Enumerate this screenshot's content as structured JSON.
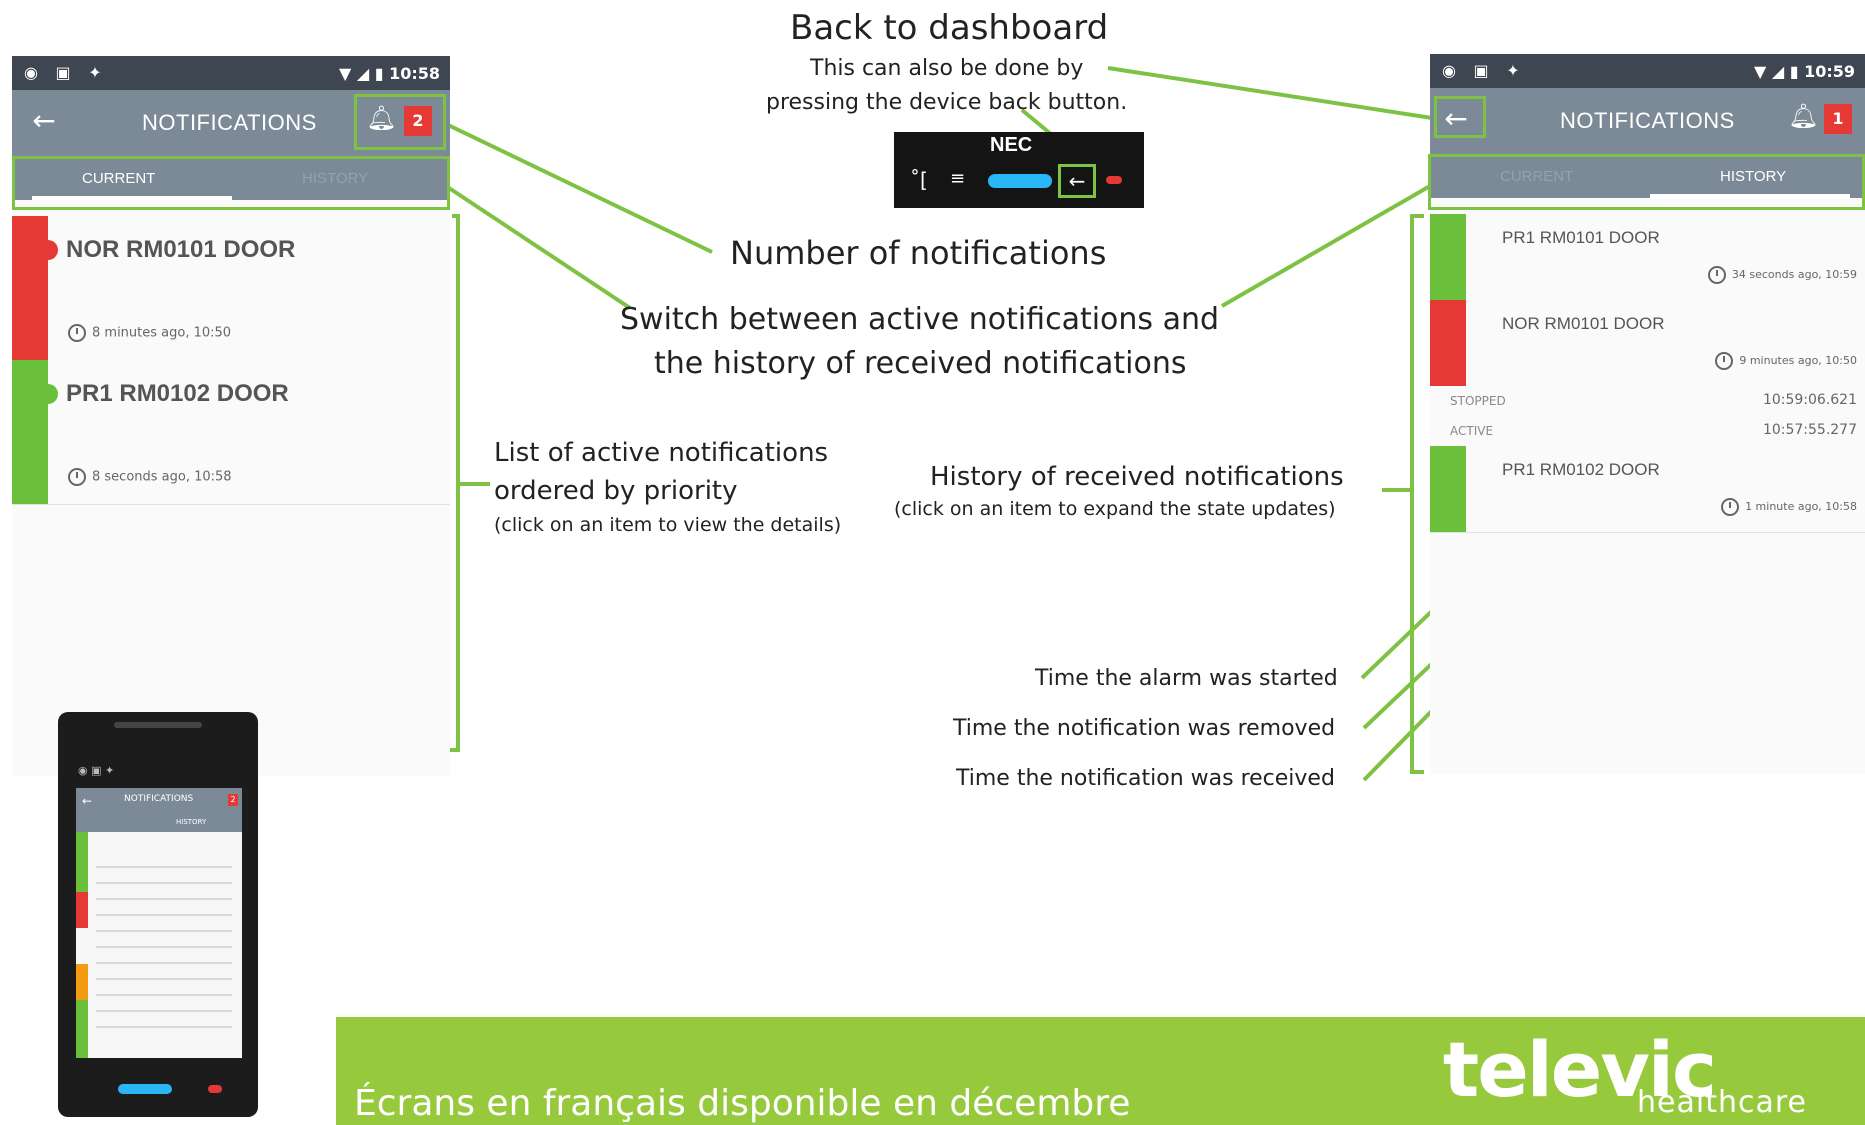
{
  "annotations": {
    "back_title": "Back to dashboard",
    "back_line1": "This can also be done by",
    "back_line2": "pressing the device back button.",
    "number": "Number of notifications",
    "switch_line1": "Switch between active notifications and",
    "switch_line2": "the history of received notifications",
    "list_line1": "List of active notifications",
    "list_line2": "ordered by priority",
    "list_line3": "(click on an item to view the details)",
    "history_line1": "History of received notifications",
    "history_line2": "(click on an item to expand the state updates)",
    "time_started": "Time the alarm was started",
    "time_removed": "Time the notification was removed",
    "time_received": "Time the notification was received"
  },
  "left_screen": {
    "time": "10:58",
    "title": "NOTIFICATIONS",
    "badge": "2",
    "tab_current": "CURRENT",
    "tab_history": "HISTORY",
    "items": [
      {
        "title": "NOR RM0101 DOOR",
        "time": "8 minutes ago, 10:50",
        "color": "#e53935"
      },
      {
        "title": "PR1 RM0102 DOOR",
        "time": "8 seconds ago, 10:58",
        "color": "#6abf3b"
      }
    ]
  },
  "right_screen": {
    "time": "10:59",
    "title": "NOTIFICATIONS",
    "badge": "1",
    "tab_current": "CURRENT",
    "tab_history": "HISTORY",
    "items": [
      {
        "title": "PR1 RM0101 DOOR",
        "time": "34 seconds ago, 10:59",
        "color": "#6abf3b"
      },
      {
        "title": "NOR RM0101 DOOR",
        "time": "9 minutes ago, 10:50",
        "color": "#e53935"
      },
      {
        "title": "PR1 RM0102 DOOR",
        "time": "1 minute ago, 10:58",
        "color": "#6abf3b"
      }
    ],
    "states": [
      {
        "label": "STOPPED",
        "value": "10:59:06.621"
      },
      {
        "label": "ACTIVE",
        "value": "10:57:55.277"
      }
    ]
  },
  "keypad": {
    "brand": "NEC"
  },
  "device": {
    "title": "NOTIFICATIONS",
    "badge": "2",
    "tab": "HISTORY"
  },
  "banner": {
    "text": "Écrans en français disponible en décembre",
    "brand": "televic",
    "brand_sub": "healthcare",
    "color": "#97c93d"
  },
  "accent": "#7dc242"
}
